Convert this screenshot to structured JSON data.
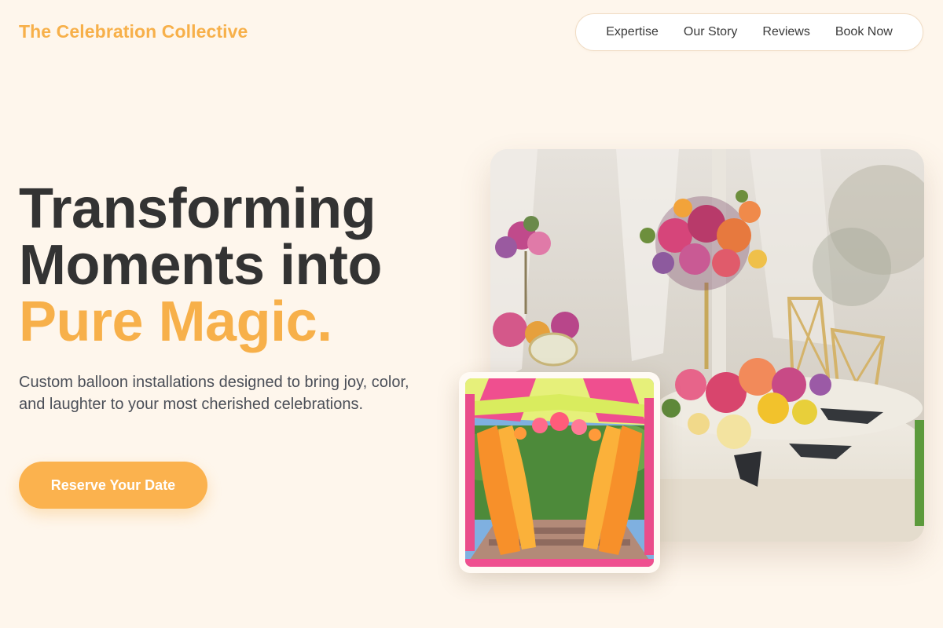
{
  "header": {
    "brand": "The Celebration Collective",
    "nav": [
      {
        "label": "Expertise"
      },
      {
        "label": "Our Story"
      },
      {
        "label": "Reviews"
      },
      {
        "label": "Book Now"
      }
    ]
  },
  "hero": {
    "headline_line1": "Transforming",
    "headline_line2": "Moments into",
    "headline_accent": "Pure Magic.",
    "subtitle": "Custom balloon installations designed to bring joy, color, and laughter to your most cherished celebrations.",
    "cta_label": "Reserve Your Date"
  },
  "images": {
    "main_alt": "Floral table centerpiece with pink and orange flowers at a garden event",
    "inset_alt": "Colorful draped entrance arch with orange and pink curtains"
  },
  "colors": {
    "background": "#fef6ec",
    "accent": "#f7b04a",
    "text": "#333333",
    "muted_text": "#4b4f58"
  }
}
